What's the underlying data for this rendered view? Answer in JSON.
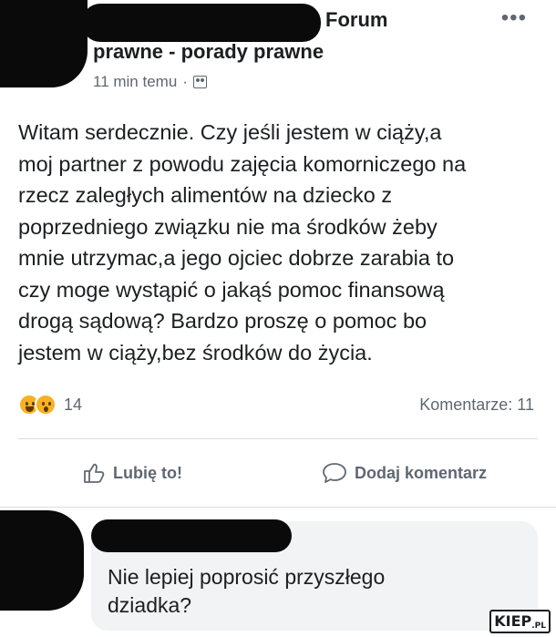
{
  "post": {
    "group_name_line1": "Forum",
    "group_name_line2": "prawne - porady prawne",
    "time": "11 min temu",
    "separator": "·",
    "audience_icon": "group-icon",
    "more_icon": "more-icon",
    "body": [
      "Witam serdecznie. Czy jeśli jestem w ciąży,a",
      "moj partner z powodu zajęcia komorniczego na",
      "rzecz zaległych alimentów na dziecko z",
      "poprzedniego związku nie ma środków żeby",
      "mnie utrzymac,a jego ojciec dobrze zarabia to",
      "czy moge wystąpić o jakąś pomoc finansową",
      "drogą sądową? Bardzo proszę o pomoc bo",
      "jestem w ciąży,bez środków do życia."
    ],
    "reactions": {
      "icons": [
        "haha-reaction-icon",
        "wow-reaction-icon"
      ],
      "count": "14"
    },
    "comments_count": "Komentarze: 11",
    "actions": {
      "like_label": "Lubię to!",
      "comment_label": "Dodaj komentarz"
    }
  },
  "comment": {
    "text_line1": "Nie lepiej poprosić przyszłego",
    "text_line2": "dziadka?"
  },
  "watermark": {
    "main": "KIEP",
    "suffix": ".PL"
  },
  "colors": {
    "text": "#1c1e21",
    "secondary_text": "#606770",
    "bubble": "#f2f3f5",
    "redaction": "#0a0a0a"
  }
}
